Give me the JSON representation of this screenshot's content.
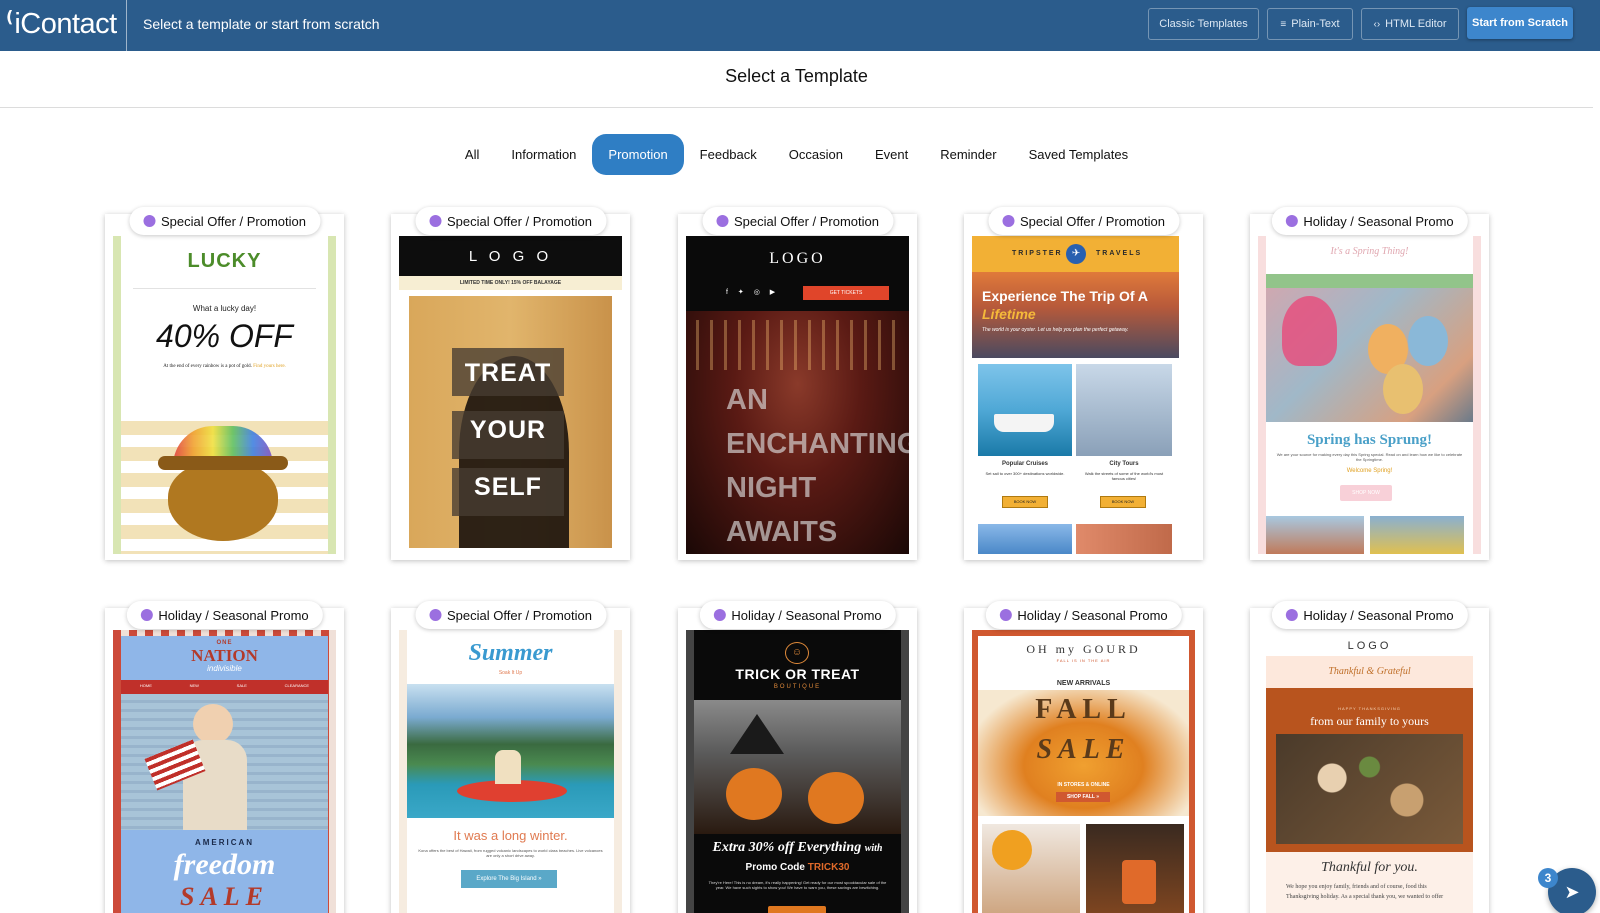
{
  "header": {
    "logo": "iContact",
    "title": "Select a template or start from scratch",
    "buttons": {
      "classic": "Classic Templates",
      "plain": "Plain-Text",
      "html": "HTML Editor",
      "start": "Start from Scratch"
    }
  },
  "page_title": "Select a Template",
  "filters": [
    "All",
    "Information",
    "Promotion",
    "Feedback",
    "Occasion",
    "Event",
    "Reminder",
    "Saved Templates"
  ],
  "active_filter": "Promotion",
  "accent_color": "#2f7ec4",
  "header_color": "#2b5c8c",
  "category_dot_color": "#9b6fe0",
  "templates": [
    {
      "category": "Special Offer / Promotion",
      "lines": [
        "LUCKY",
        "What a lucky day!",
        "40% OFF",
        "At the end of every rainbow is a pot of gold.",
        "Find yours here."
      ]
    },
    {
      "category": "Special Offer / Promotion",
      "lines": [
        "L O G O",
        "LIMITED TIME ONLY! 15% OFF BALAYAGE",
        "TREAT",
        "YOUR",
        "SELF"
      ]
    },
    {
      "category": "Special Offer / Promotion",
      "lines": [
        "LOGO",
        "GET TICKETS",
        "AN",
        "ENCHANTING",
        "NIGHT",
        "AWAITS"
      ]
    },
    {
      "category": "Special Offer / Promotion",
      "lines": [
        "TRIPSTER",
        "TRAVELS",
        "Experience The Trip Of A",
        "Lifetime",
        "The world is your oyster. Let us help you plan the perfect getaway.",
        "Popular Cruises",
        "Set sail to over 300+ destinations worldwide.",
        "City Tours",
        "Walk the streets of some of the world's most famous cities!",
        "BOOK NOW",
        "BOOK NOW"
      ]
    },
    {
      "category": "Holiday / Seasonal Promo",
      "lines": [
        "It's a Spring Thing!",
        "Spring has Sprung!",
        "We are your source for making every day this Spring special. Read on and learn how we like to celebrate the Springtime.",
        "Welcome Spring!",
        "SHOP NOW"
      ]
    },
    {
      "category": "Holiday / Seasonal Promo",
      "lines": [
        "ONE",
        "NATION",
        "indivisible",
        "HOME",
        "NEW",
        "SALE",
        "CLEARANCE",
        "AMERICAN",
        "freedom",
        "SALE"
      ]
    },
    {
      "category": "Special Offer / Promotion",
      "lines": [
        "Summer",
        "Soak It Up",
        "It was a long winter.",
        "Kona offers the best of Hawaii, from rugged volcanic landscapes to world class beaches. Live volcanoes are only a short drive away.",
        "Explore The Big Island »"
      ]
    },
    {
      "category": "Holiday / Seasonal Promo",
      "lines": [
        "TRICK OR TREAT",
        "BOUTIQUE",
        "Extra 30% off Everything",
        "with",
        "Promo Code",
        "TRICK30",
        "They're Here! This is no dream, it's really happening! Get ready for our most spooktacular sale of the year. We have such sights to show you! We have to warn you, these savings are bewitching."
      ]
    },
    {
      "category": "Holiday / Seasonal Promo",
      "lines": [
        "OH my GOURD",
        "FALL IS IN THE AIR",
        "NEW ARRIVALS",
        "FALL",
        "SALE",
        "IN STORES & ONLINE",
        "SHOP FALL »"
      ]
    },
    {
      "category": "Holiday / Seasonal Promo",
      "lines": [
        "LOGO",
        "Thankful & Grateful",
        "HAPPY THANKSGIVING",
        "from our family to yours",
        "Thankful for you.",
        "We hope you enjoy family, friends and of course, food this Thanksgiving holiday. As a special thank you, we wanted to offer"
      ]
    }
  ],
  "chat": {
    "badge": "3"
  }
}
